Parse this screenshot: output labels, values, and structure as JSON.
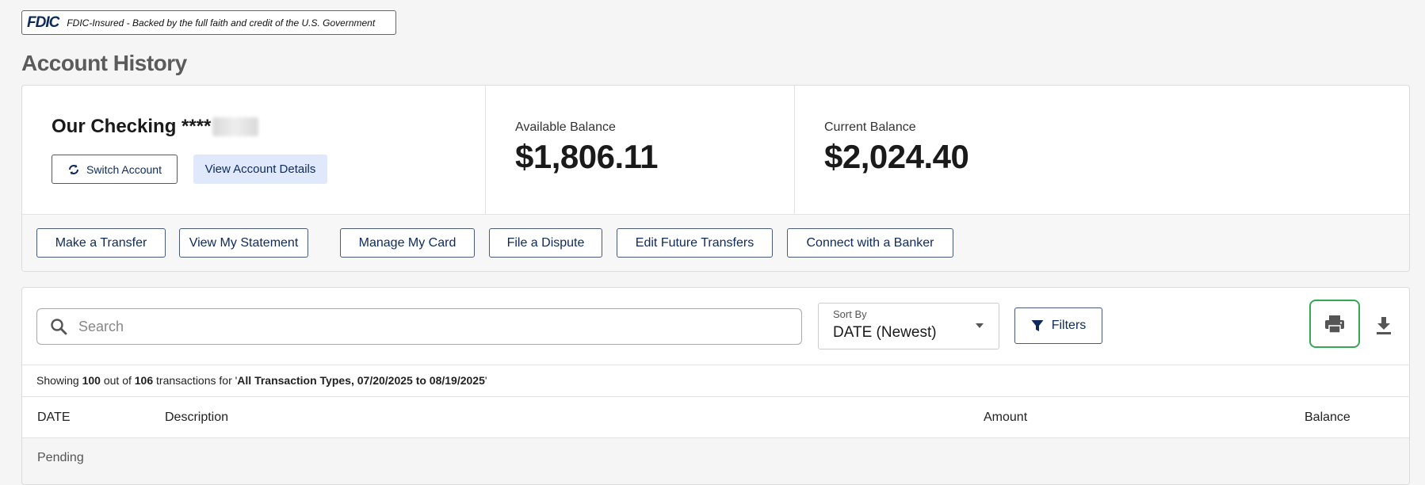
{
  "fdic": {
    "logo": "FDIC",
    "text": "FDIC-Insured - Backed by the full faith and credit of the U.S. Government"
  },
  "page": {
    "title": "Account History"
  },
  "account": {
    "name": "Our Checking ****",
    "switch_label": "Switch Account",
    "details_label": "View Account Details",
    "available_label": "Available Balance",
    "available_value": "$1,806.11",
    "current_label": "Current Balance",
    "current_value": "$2,024.40"
  },
  "actions": [
    "Make a Transfer",
    "View My Statement",
    "Manage My Card",
    "File a Dispute",
    "Edit Future Transfers",
    "Connect with a Banker"
  ],
  "transactions": {
    "search_placeholder": "Search",
    "sort_label": "Sort By",
    "sort_value": "DATE (Newest)",
    "filters_label": "Filters",
    "showing": {
      "prefix": "Showing ",
      "shown": "100",
      "middle": " out of ",
      "total": "106",
      "suffix_start": " transactions for '",
      "criteria": "All Transaction Types, 07/20/2025 to 08/19/2025",
      "suffix_end": "'"
    },
    "columns": {
      "date": "DATE",
      "description": "Description",
      "amount": "Amount",
      "balance": "Balance"
    },
    "pending_label": "Pending"
  },
  "colors": {
    "accent": "#0e2a5c",
    "print_highlight": "#35a853",
    "details_button_bg": "#dfe9fb"
  },
  "icons": {
    "switch": "refresh-icon",
    "search": "search-icon",
    "sort": "chevron-down-icon",
    "filter": "filter-icon",
    "print": "printer-icon",
    "download": "download-icon"
  }
}
